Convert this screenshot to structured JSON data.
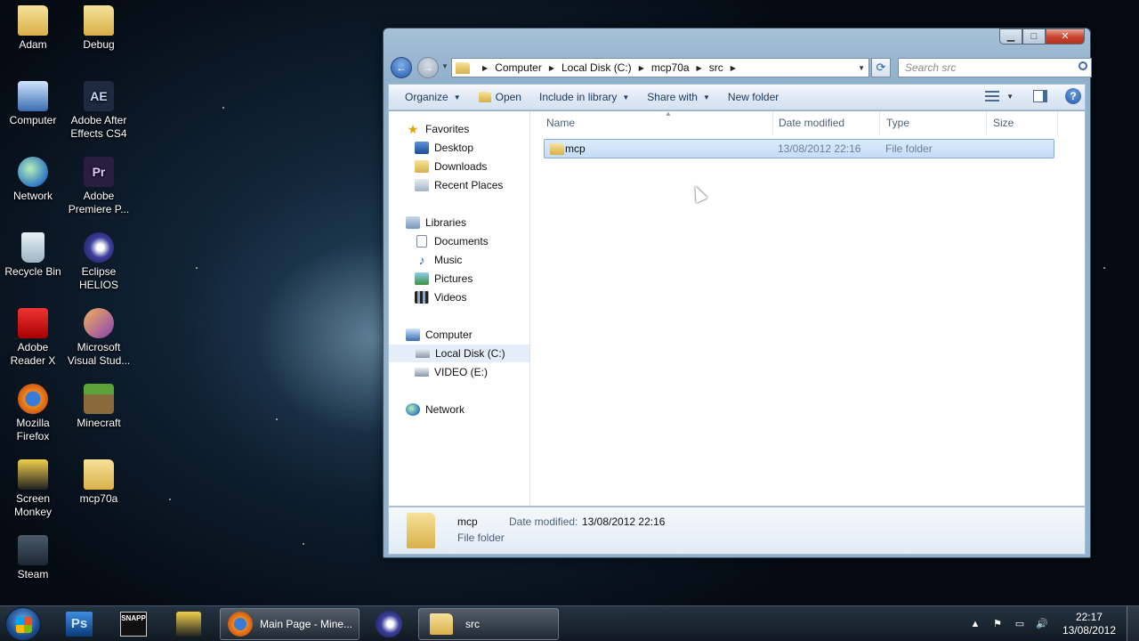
{
  "desktop": {
    "icons": [
      {
        "label": "Adam",
        "icon": "folder-icon"
      },
      {
        "label": "Debug",
        "icon": "folder-icon"
      },
      {
        "label": "Computer",
        "icon": "computer-icon"
      },
      {
        "label": "Adobe After Effects CS4",
        "icon": "after-effects-icon"
      },
      {
        "label": "Network",
        "icon": "network-icon"
      },
      {
        "label": "Adobe Premiere P...",
        "icon": "premiere-icon"
      },
      {
        "label": "Recycle Bin",
        "icon": "recycle-bin-icon"
      },
      {
        "label": "Eclipse HELIOS",
        "icon": "eclipse-icon"
      },
      {
        "label": "Adobe Reader X",
        "icon": "adobe-reader-icon"
      },
      {
        "label": "Microsoft Visual Stud...",
        "icon": "visual-studio-icon"
      },
      {
        "label": "Mozilla Firefox",
        "icon": "firefox-icon"
      },
      {
        "label": "Minecraft",
        "icon": "minecraft-icon"
      },
      {
        "label": "Screen Monkey",
        "icon": "screen-monkey-icon"
      },
      {
        "label": "mcp70a",
        "icon": "folder-icon"
      },
      {
        "label": "Steam",
        "icon": "steam-icon"
      }
    ]
  },
  "explorer": {
    "breadcrumb": [
      "Computer",
      "Local Disk (C:)",
      "mcp70a",
      "src"
    ],
    "search_placeholder": "Search src",
    "toolbar": {
      "organize": "Organize",
      "open": "Open",
      "include_in_library": "Include in library",
      "share_with": "Share with",
      "new_folder": "New folder"
    },
    "nav": {
      "favorites": "Favorites",
      "desktop": "Desktop",
      "downloads": "Downloads",
      "recent_places": "Recent Places",
      "libraries": "Libraries",
      "documents": "Documents",
      "music": "Music",
      "pictures": "Pictures",
      "videos": "Videos",
      "computer": "Computer",
      "local_disk": "Local Disk (C:)",
      "video_drive": "VIDEO (E:)",
      "network": "Network"
    },
    "columns": {
      "name": "Name",
      "date_modified": "Date modified",
      "type": "Type",
      "size": "Size"
    },
    "files": [
      {
        "name": "mcp",
        "date_modified": "13/08/2012 22:16",
        "type": "File folder",
        "size": ""
      }
    ],
    "details": {
      "name": "mcp",
      "type": "File folder",
      "modified_label": "Date modified:",
      "modified_value": "13/08/2012 22:16"
    }
  },
  "taskbar": {
    "pinned": [
      "photoshop-icon",
      "snapp-icon",
      "screen-monkey-icon"
    ],
    "ps_label": "Ps",
    "snapp_label": "SNAPP",
    "firefox_task": "Main Page - Mine...",
    "explorer_task": "src",
    "clock_time": "22:17",
    "clock_date": "13/08/2012"
  },
  "colors": {
    "accent": "#2356a8",
    "selection": "#c4dcf7"
  }
}
